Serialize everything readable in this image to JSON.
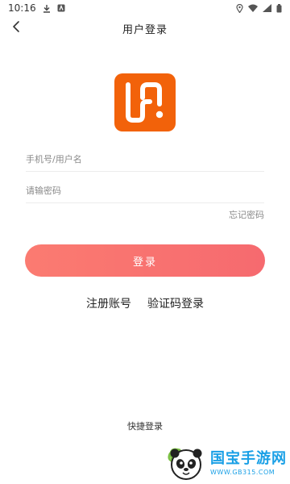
{
  "status_bar": {
    "time": "10:16",
    "icons": [
      "download-icon",
      "notification-icon",
      "location-icon",
      "wifi-icon",
      "signal-icon",
      "battery-icon"
    ]
  },
  "header": {
    "title": "用户登录",
    "back_icon": "chevron-left-icon"
  },
  "logo": {
    "icon": "app-logo-icon",
    "color": "#f2620a"
  },
  "form": {
    "username_placeholder": "手机号/用户名",
    "username_value": "",
    "password_placeholder": "请输密码",
    "password_value": "",
    "forgot_password": "忘记密码"
  },
  "actions": {
    "login_label": "登录",
    "login_color_start": "#fb7b71",
    "login_color_end": "#f66a6f",
    "register_label": "注册账号",
    "sms_login_label": "验证码登录",
    "quick_login_label": "快捷登录"
  },
  "watermark": {
    "title": "国宝手游网",
    "url": "WWW.GB315.COM",
    "icon": "panda-icon"
  }
}
